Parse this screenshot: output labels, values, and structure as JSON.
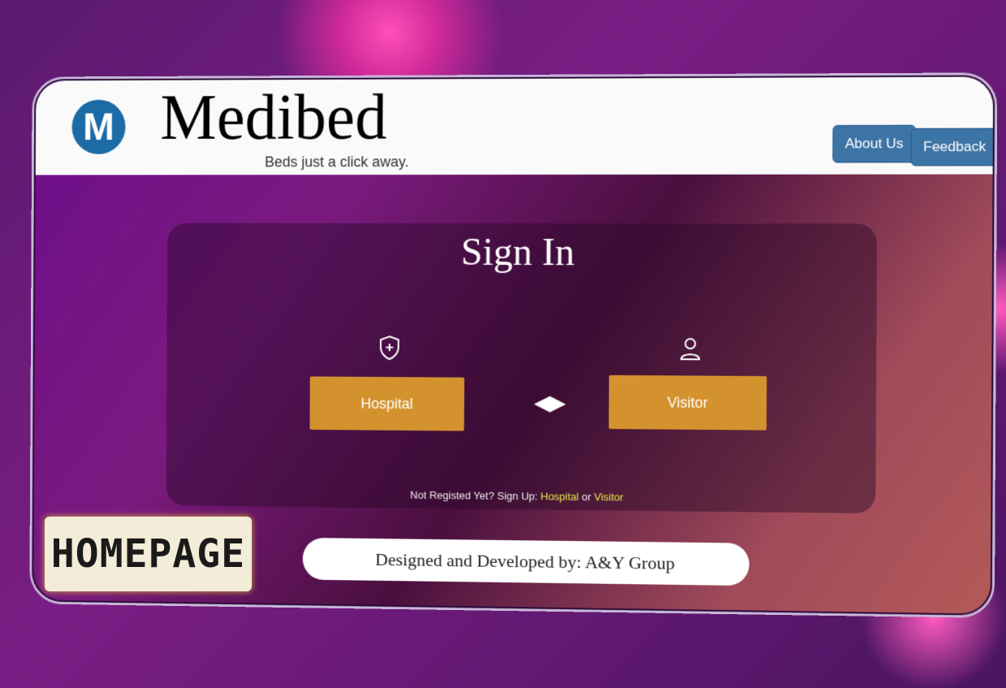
{
  "header": {
    "brand": "Medibed",
    "tagline": "Beds just a click away.",
    "logo_letter": "M",
    "about_label": "About Us",
    "feedback_label": "Feedback"
  },
  "signin": {
    "title": "Sign In",
    "hospital_label": "Hospital",
    "visitor_label": "Visitor",
    "hospital_icon": "shield-plus-icon",
    "visitor_icon": "user-icon",
    "swap_icon": "left-right-arrows-icon",
    "note_prefix": "Not Registed Yet? Sign Up: ",
    "note_hospital": "Hospital",
    "note_or": " or ",
    "note_visitor": "Visitor"
  },
  "footer": {
    "credit": "Designed and Developed by: A&Y Group"
  },
  "overlay": {
    "stamp": "HOMEPAGE"
  },
  "colors": {
    "accent": "#d4922e",
    "nav_button": "#3d74a6",
    "link": "#e8e84a"
  }
}
